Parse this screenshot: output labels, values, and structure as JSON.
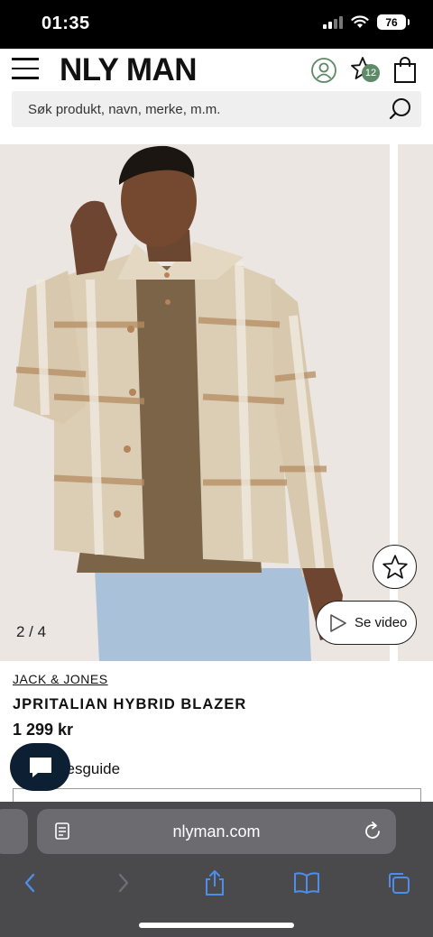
{
  "status": {
    "time": "01:35",
    "battery": "76"
  },
  "header": {
    "logo": "NLY MAN",
    "favorites_count": "12"
  },
  "search": {
    "placeholder": "Søk produkt, navn, merke, m.m."
  },
  "gallery": {
    "counter": "2 / 4",
    "video_label": "Se video"
  },
  "product": {
    "brand": "JACK & JONES",
    "name": "JPRITALIAN HYBRID BLAZER",
    "price": "1 299 kr",
    "size_guide": "Størrelsesguide"
  },
  "browser": {
    "url": "nlyman.com"
  },
  "colors": {
    "chat": "#0d2033",
    "badge": "#5f8a67",
    "safari_bg": "#4a4a4d",
    "safari_icon": "#4d8fe8"
  },
  "icons": [
    "menu-icon",
    "account-icon",
    "star-icon",
    "bag-icon",
    "search-icon",
    "play-icon",
    "chat-icon",
    "reader-icon",
    "reload-icon",
    "back-icon",
    "forward-icon",
    "share-icon",
    "bookmarks-icon",
    "tabs-icon"
  ]
}
